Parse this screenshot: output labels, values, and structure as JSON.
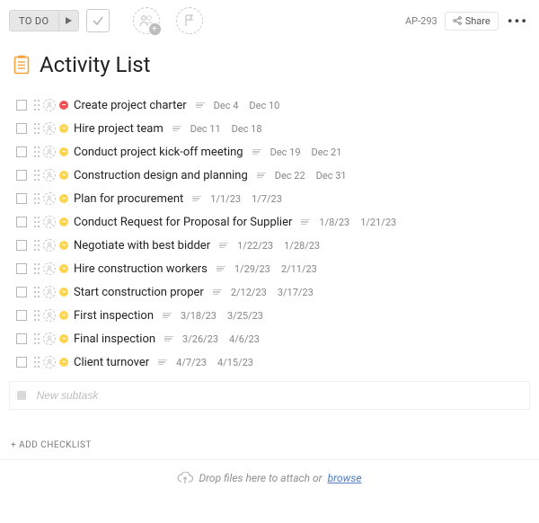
{
  "toolbar": {
    "status_label": "TO DO",
    "share_label": "Share",
    "task_id": "AP-293"
  },
  "title": "Activity List",
  "rows": [
    {
      "priority": "red",
      "name": "Create project charter",
      "start": "Dec 4",
      "end": "Dec 10"
    },
    {
      "priority": "yellow",
      "name": "Hire project team",
      "start": "Dec 11",
      "end": "Dec 18"
    },
    {
      "priority": "yellow",
      "name": "Conduct project kick-off meeting",
      "start": "Dec 19",
      "end": "Dec 21"
    },
    {
      "priority": "yellow",
      "name": "Construction design and planning",
      "start": "Dec 22",
      "end": "Dec 31"
    },
    {
      "priority": "yellow",
      "name": "Plan for procurement",
      "start": "1/1/23",
      "end": "1/7/23"
    },
    {
      "priority": "yellow",
      "name": "Conduct Request for Proposal for Supplier",
      "start": "1/8/23",
      "end": "1/21/23"
    },
    {
      "priority": "yellow",
      "name": "Negotiate with best bidder",
      "start": "1/22/23",
      "end": "1/28/23"
    },
    {
      "priority": "yellow",
      "name": "Hire construction workers",
      "start": "1/29/23",
      "end": "2/11/23"
    },
    {
      "priority": "yellow",
      "name": "Start construction proper",
      "start": "2/12/23",
      "end": "3/17/23"
    },
    {
      "priority": "yellow",
      "name": "First inspection",
      "start": "3/18/23",
      "end": "3/25/23"
    },
    {
      "priority": "yellow",
      "name": "Final inspection",
      "start": "3/26/23",
      "end": "4/6/23"
    },
    {
      "priority": "yellow",
      "name": "Client turnover",
      "start": "4/7/23",
      "end": "4/15/23"
    }
  ],
  "new_subtask_placeholder": "New subtask",
  "add_checklist_label": "+ ADD CHECKLIST",
  "drop": {
    "prefix": "Drop files here to attach or ",
    "link": "browse"
  }
}
